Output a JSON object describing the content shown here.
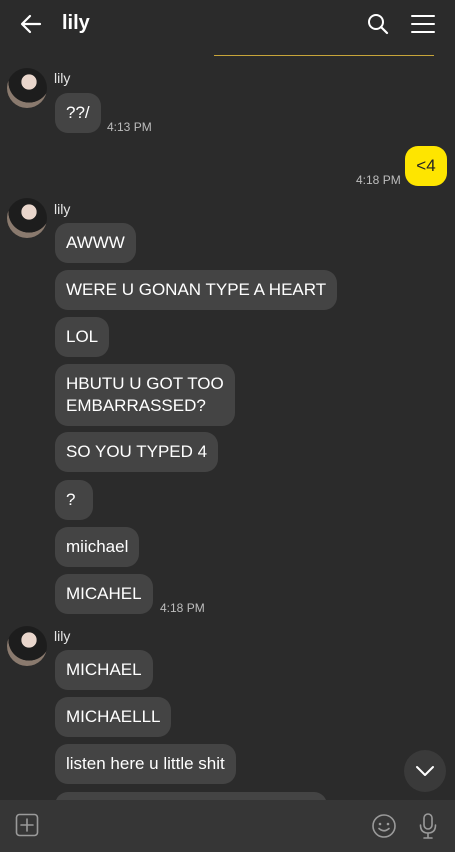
{
  "header": {
    "title": "lily"
  },
  "messages": {
    "g1": {
      "sender": "lily",
      "m1": "??/",
      "time": "4:13 PM"
    },
    "me": {
      "m1": "<4",
      "time": "4:18 PM"
    },
    "g2": {
      "sender": "lily",
      "m1": "AWWW",
      "m2": "WERE U GONAN TYPE A HEART",
      "m3": "LOL",
      "m4": "HBUTU U GOT TOO\nEMBARRASSED?",
      "m5": "SO YOU TYPED 4",
      "m6": "?",
      "m7": "miichael",
      "m8": "MICAHEL",
      "time": "4:18 PM"
    },
    "g3": {
      "sender": "lily",
      "m1": "MICHAEL",
      "m2": "MICHAELLL",
      "m3": "listen here u little shit"
    }
  },
  "colors": {
    "background": "#2b2b2b",
    "their_bubble": "#444444",
    "my_bubble": "#fee500",
    "notice_line": "#c7a53a"
  },
  "icons": [
    "back-arrow-icon",
    "search-icon",
    "menu-icon",
    "chevron-down-icon",
    "plus-icon",
    "emoji-icon",
    "microphone-icon"
  ]
}
